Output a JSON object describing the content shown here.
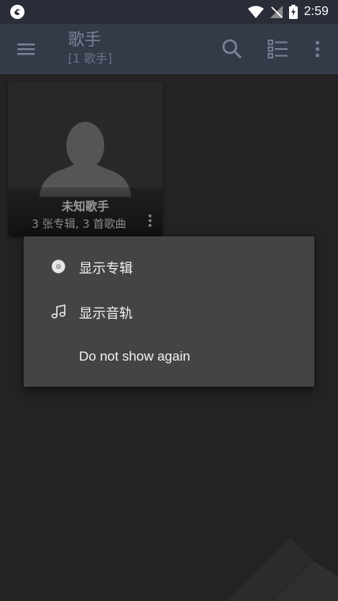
{
  "status_bar": {
    "time": "2:59",
    "icons": [
      "app-logo-icon",
      "wifi-icon",
      "no-signal-icon",
      "battery-charging-icon"
    ]
  },
  "toolbar": {
    "title": "歌手",
    "subtitle": "[1 歌手]",
    "icons": [
      "menu-icon",
      "search-icon",
      "list-view-icon",
      "more-vert-icon"
    ]
  },
  "artist_card": {
    "name": "未知歌手",
    "stats": "3 张专辑, 3 首歌曲"
  },
  "popup_menu": {
    "items": [
      {
        "label": "显示专辑",
        "icon": "album-disc-icon"
      },
      {
        "label": "显示音轨",
        "icon": "music-note-icon"
      },
      {
        "label": "Do not show again",
        "icon": ""
      }
    ]
  },
  "colors": {
    "toolbar_bg": "#353a49",
    "status_bar_bg": "#2a2d37",
    "content_bg": "#232323",
    "popup_bg": "#444444"
  }
}
